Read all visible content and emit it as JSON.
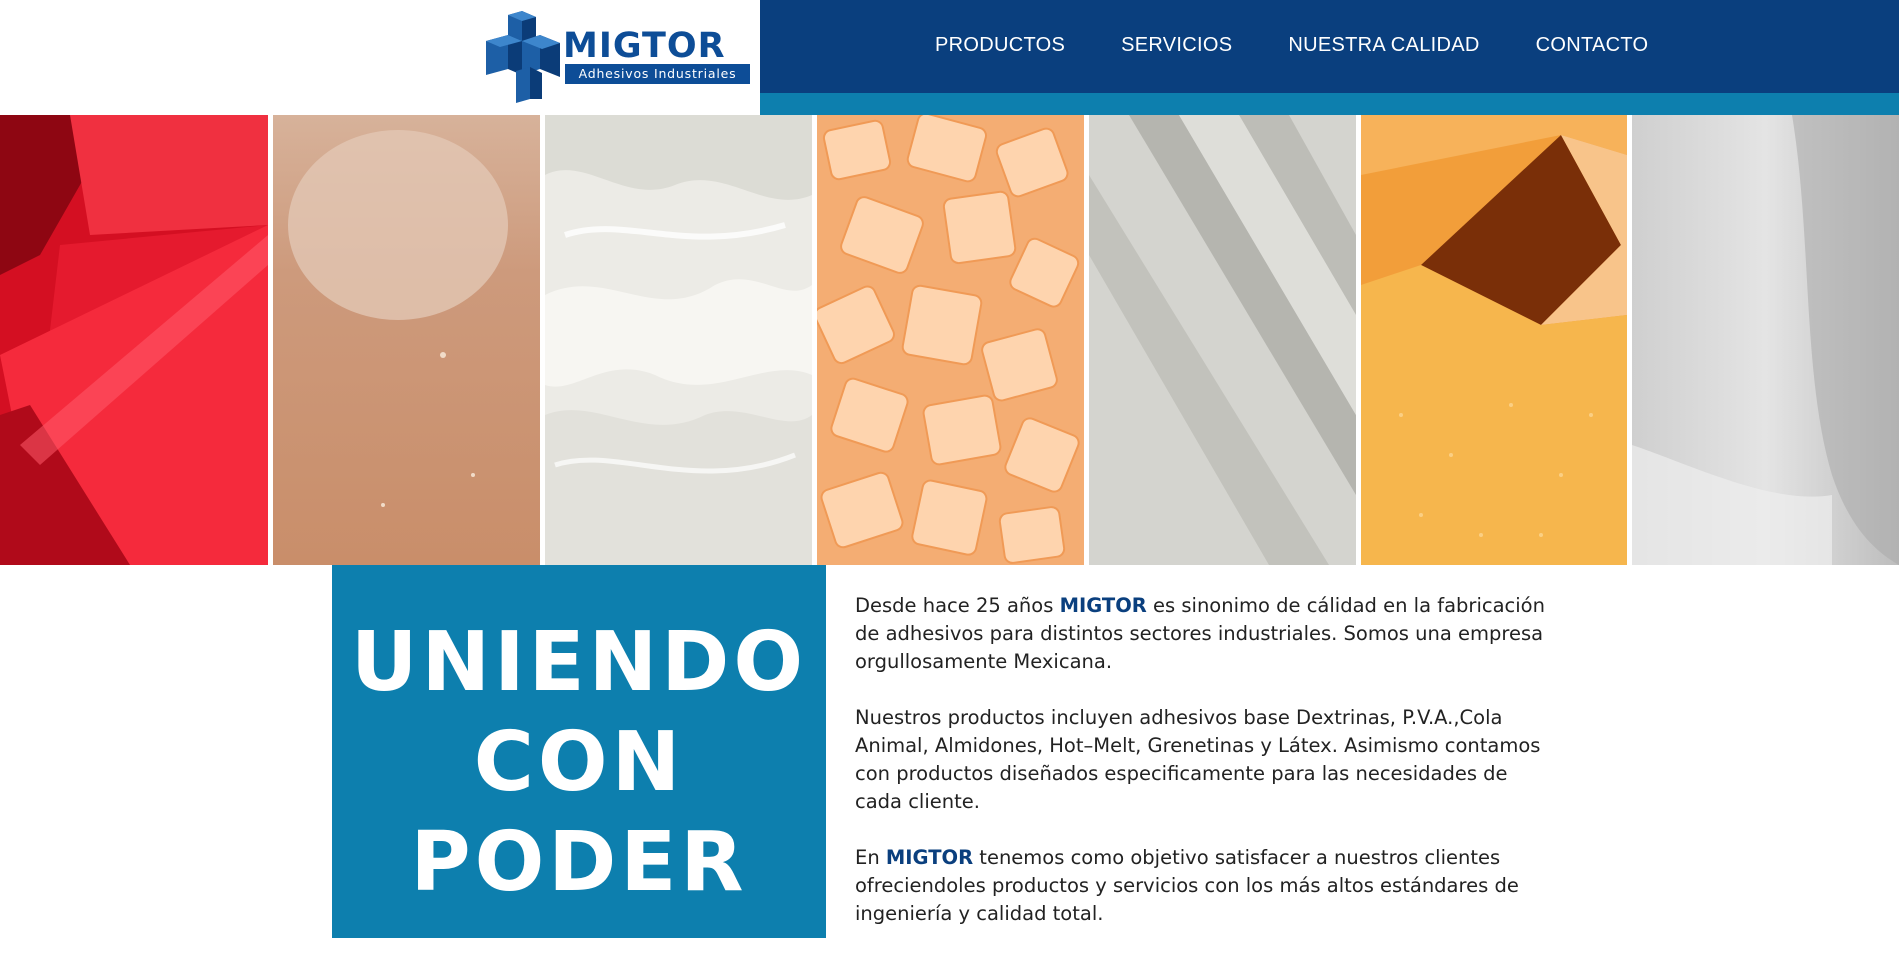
{
  "logo": {
    "name": "MIGTOR",
    "tagline": "Adhesivos Industriales"
  },
  "nav": {
    "items": [
      "PRODUCTOS",
      "SERVICIOS",
      "NUESTRA CALIDAD",
      "CONTACTO"
    ]
  },
  "hero": {
    "panels": [
      {
        "name": "red-adhesive-panel",
        "color": "#e0142a"
      },
      {
        "name": "tan-adhesive-panel",
        "color": "#c99473"
      },
      {
        "name": "white-adhesive-panel",
        "color": "#e9e7e1"
      },
      {
        "name": "amber-pellets-panel",
        "color": "#f6b57e"
      },
      {
        "name": "grey-adhesive-panel",
        "color": "#cbcbc6"
      },
      {
        "name": "orange-adhesive-panel",
        "color": "#f2a13f"
      },
      {
        "name": "light-grey-adhesive-panel",
        "color": "#d9d9d9"
      }
    ]
  },
  "slogan": {
    "lines": [
      "UNIENDO",
      "CON",
      "PODER"
    ]
  },
  "intro": {
    "p1_before": "Desde hace 25 años ",
    "p1_brand": "MIGTOR",
    "p1_after": " es sinonimo de cálidad en la fabricación de adhesivos para distintos sectores industriales. Somos una empresa orgullosamente Mexicana.",
    "p2": "Nuestros productos incluyen adhesivos base Dextrinas, P.V.A.,Cola Animal, Almidones, Hot–Melt, Grenetinas y Látex. Asimismo contamos con productos diseñados especificamente para las necesidades de cada cliente.",
    "p3_before": "En ",
    "p3_brand": "MIGTOR",
    "p3_after": " tenemos como objetivo satisfacer a nuestros clientes ofreciendoles productos y servicios con los más altos estándares de ingeniería y calidad total."
  },
  "colors": {
    "nav_bg": "#0a3f7e",
    "accent": "#0d7fae",
    "brand": "#0d4d97"
  }
}
